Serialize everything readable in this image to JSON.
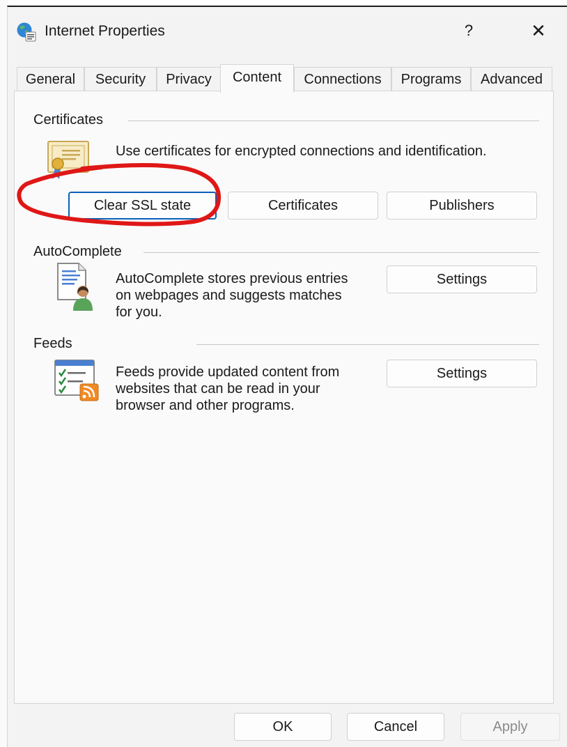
{
  "window": {
    "title": "Internet Properties",
    "help_label": "?",
    "close_label": "✕"
  },
  "tabs": [
    {
      "label": "General"
    },
    {
      "label": "Security"
    },
    {
      "label": "Privacy"
    },
    {
      "label": "Content",
      "active": true
    },
    {
      "label": "Connections"
    },
    {
      "label": "Programs"
    },
    {
      "label": "Advanced"
    }
  ],
  "certificates": {
    "group_label": "Certificates",
    "description": "Use certificates for encrypted connections and identification.",
    "clear_ssl_label": "Clear SSL state",
    "certificates_label": "Certificates",
    "publishers_label": "Publishers"
  },
  "autocomplete": {
    "group_label": "AutoComplete",
    "description_lines": [
      "AutoComplete stores previous entries",
      "on webpages and suggests matches",
      "for you."
    ],
    "settings_label": "Settings"
  },
  "feeds": {
    "group_label": "Feeds",
    "description_lines": [
      "Feeds provide updated content from",
      "websites that can be read in your",
      "browser and other programs."
    ],
    "settings_label": "Settings"
  },
  "footer": {
    "ok_label": "OK",
    "cancel_label": "Cancel",
    "apply_label": "Apply"
  },
  "colors": {
    "focus_border": "#0a60b8",
    "annotation_red": "#e01717",
    "feeds_rss": "#f08a24"
  },
  "icons": {
    "title": "internet-globe-icon",
    "certificates": "certificate-icon",
    "autocomplete": "autocomplete-user-icon",
    "feeds": "feeds-rss-icon"
  }
}
